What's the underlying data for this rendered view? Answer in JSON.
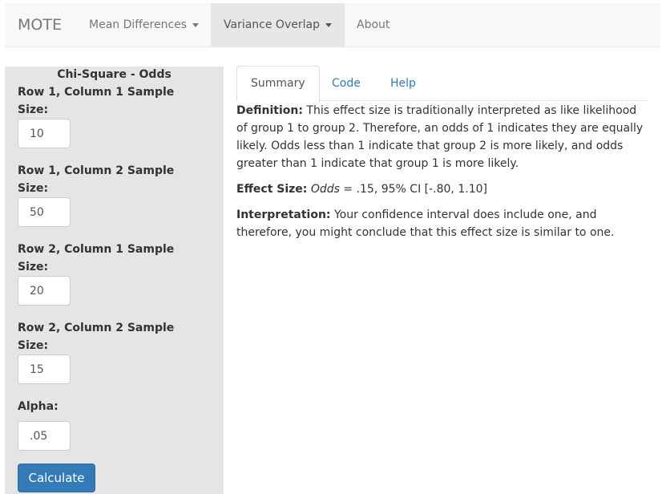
{
  "navbar": {
    "brand": "MOTE",
    "items": [
      {
        "label": "Mean Differences",
        "dropdown": true,
        "active": false
      },
      {
        "label": "Variance Overlap",
        "dropdown": true,
        "active": true
      },
      {
        "label": "About",
        "dropdown": false,
        "active": false
      }
    ]
  },
  "sidebar": {
    "title": "Chi-Square - Odds",
    "fields": [
      {
        "label": "Row 1, Column 1 Sample Size:",
        "value": "10"
      },
      {
        "label": "Row 1, Column 2 Sample Size:",
        "value": "50"
      },
      {
        "label": "Row 2, Column 1 Sample Size:",
        "value": "20"
      },
      {
        "label": "Row 2, Column 2 Sample Size:",
        "value": "15"
      },
      {
        "label": "Alpha:",
        "value": ".05"
      }
    ],
    "calculate_label": "Calculate"
  },
  "tabs": [
    {
      "label": "Summary",
      "active": true
    },
    {
      "label": "Code",
      "active": false
    },
    {
      "label": "Help",
      "active": false
    }
  ],
  "summary": {
    "definition_label": "Definition:",
    "definition_text": " This effect size is traditionally interpreted as like likelihood of group 1 to group 2. Therefore, an odds of 1 indicates they are equally likely. Odds less than 1 indicate that group 2 is more likely, and odds greater than 1 indicate that group 1 is more likely.",
    "effect_size_label": "Effect Size:",
    "effect_symbol": "Odds",
    "effect_value": " = .15, 95% CI [-.80, 1.10]",
    "interpretation_label": "Interpretation:",
    "interpretation_text": " Your confidence interval does include one, and therefore, you might conclude that this effect size is similar to one."
  },
  "colors": {
    "primary": "#337ab7",
    "navbar_bg": "#f8f8f8",
    "sidebar_bg": "#e5e5e5"
  }
}
